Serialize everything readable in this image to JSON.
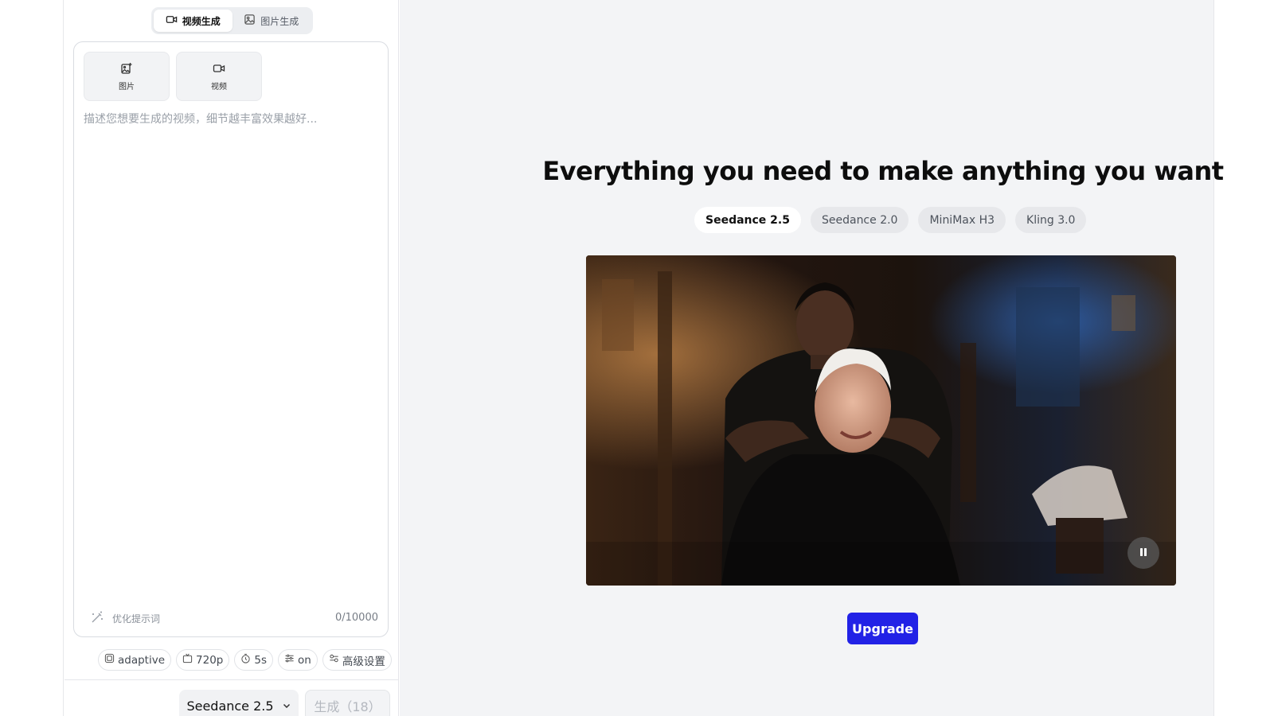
{
  "mode_tabs": [
    {
      "label": "视频生成",
      "icon": "video-camera-icon",
      "active": true
    },
    {
      "label": "图片生成",
      "icon": "image-icon",
      "active": false
    }
  ],
  "upload_tiles": [
    {
      "label": "图片",
      "icon": "add-image-icon"
    },
    {
      "label": "视频",
      "icon": "video-camera-icon"
    }
  ],
  "prompt": {
    "value": "",
    "placeholder": "描述您想要生成的视频，细节越丰富效果越好..."
  },
  "optimize_label": "优化提示词",
  "char_count": "0/10000",
  "settings": [
    {
      "label": "adaptive",
      "icon": "aspect-ratio-icon"
    },
    {
      "label": "720p",
      "icon": "tv-icon"
    },
    {
      "label": "5s",
      "icon": "timer-icon"
    },
    {
      "label": "on",
      "icon": "sliders-icon"
    },
    {
      "label": "高级设置",
      "icon": "advanced-settings-icon"
    }
  ],
  "model_select": {
    "label": "Seedance 2.5",
    "icon": "chevron-down-icon"
  },
  "generate_label": "生成（18）",
  "hero": {
    "title": "Everything you need to make anything you want"
  },
  "model_tabs": [
    {
      "label": "Seedance 2.5",
      "active": true
    },
    {
      "label": "Seedance 2.0",
      "active": false
    },
    {
      "label": "MiniMax H3",
      "active": false
    },
    {
      "label": "Kling 3.0",
      "active": false
    }
  ],
  "video": {
    "playing": true,
    "control_icon": "pause-icon"
  },
  "upgrade_label": "Upgrade",
  "colors": {
    "accent": "#2222e6",
    "main_bg": "#f3f4f6",
    "panel_bg": "#ffffff",
    "disabled_text": "#b4b8bf"
  }
}
